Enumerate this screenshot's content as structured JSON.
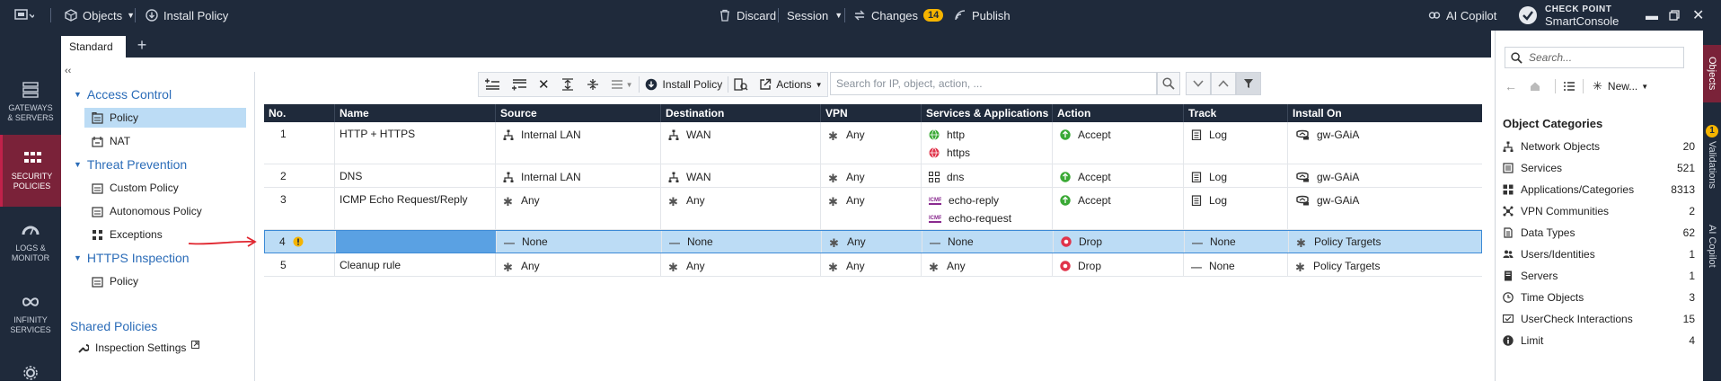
{
  "topbar": {
    "objects_label": "Objects",
    "install_label": "Install Policy",
    "discard_label": "Discard",
    "session_label": "Session",
    "changes_label": "Changes",
    "changes_count": "14",
    "publish_label": "Publish",
    "copilot_label": "AI Copilot",
    "brand_top": "CHECK POINT",
    "brand_bottom": "SmartConsole"
  },
  "tabs": {
    "active": "Standard"
  },
  "leftnav": [
    {
      "line1": "GATEWAYS",
      "line2": "& SERVERS"
    },
    {
      "line1": "SECURITY",
      "line2": "POLICIES"
    },
    {
      "line1": "LOGS &",
      "line2": "MONITOR"
    },
    {
      "line1": "INFINITY",
      "line2": "SERVICES"
    }
  ],
  "tree": {
    "access_control": "Access Control",
    "policy": "Policy",
    "nat": "NAT",
    "threat_prevention": "Threat Prevention",
    "custom_policy": "Custom Policy",
    "autonomous_policy": "Autonomous Policy",
    "exceptions": "Exceptions",
    "https_inspection": "HTTPS Inspection",
    "policy2": "Policy",
    "shared_policies": "Shared Policies",
    "inspection_settings": "Inspection Settings"
  },
  "toolbar": {
    "install_label": "Install Policy",
    "actions_label": "Actions",
    "search_placeholder": "Search for IP, object, action, ..."
  },
  "columns": [
    "No.",
    "Name",
    "Source",
    "Destination",
    "VPN",
    "Services & Applications",
    "Action",
    "Track",
    "Install On"
  ],
  "rules": [
    {
      "no": "1",
      "name": "HTTP + HTTPS",
      "source": "Internal LAN",
      "destination": "WAN",
      "vpn": "Any",
      "services": [
        "http",
        "https"
      ],
      "action": "Accept",
      "track": "Log",
      "install_on": "gw-GAiA"
    },
    {
      "no": "2",
      "name": "DNS",
      "source": "Internal LAN",
      "destination": "WAN",
      "vpn": "Any",
      "services": [
        "dns"
      ],
      "action": "Accept",
      "track": "Log",
      "install_on": "gw-GAiA"
    },
    {
      "no": "3",
      "name": "ICMP Echo Request/Reply",
      "source": "Any",
      "destination": "Any",
      "vpn": "Any",
      "services": [
        "echo-reply",
        "echo-request"
      ],
      "action": "Accept",
      "track": "Log",
      "install_on": "gw-GAiA"
    },
    {
      "no": "4",
      "name": "",
      "source": "None",
      "destination": "None",
      "vpn": "Any",
      "services": [
        "None"
      ],
      "action": "Drop",
      "track": "None",
      "install_on": "Policy Targets"
    },
    {
      "no": "5",
      "name": "Cleanup rule",
      "source": "Any",
      "destination": "Any",
      "vpn": "Any",
      "services": [
        "Any"
      ],
      "action": "Drop",
      "track": "None",
      "install_on": "Policy Targets"
    }
  ],
  "rightpanel": {
    "search_placeholder": "Search...",
    "new_label": "New...",
    "title": "Object Categories",
    "categories": [
      {
        "label": "Network Objects",
        "count": "20"
      },
      {
        "label": "Services",
        "count": "521"
      },
      {
        "label": "Applications/Categories",
        "count": "8313"
      },
      {
        "label": "VPN Communities",
        "count": "2"
      },
      {
        "label": "Data Types",
        "count": "62"
      },
      {
        "label": "Users/Identities",
        "count": "1"
      },
      {
        "label": "Servers",
        "count": "1"
      },
      {
        "label": "Time Objects",
        "count": "3"
      },
      {
        "label": "UserCheck Interactions",
        "count": "15"
      },
      {
        "label": "Limit",
        "count": "4"
      }
    ]
  },
  "vtabs": {
    "objects": "Objects",
    "validations_count": "1",
    "validations": "Validations",
    "copilot": "AI Copilot"
  },
  "colors": {
    "dark": "#1f2a3b",
    "accent": "#7a2239",
    "link": "#2b6cb8",
    "selected_row": "#bcdcf5",
    "accept": "#3aa935",
    "drop": "#e0334a",
    "badge": "#f5b400"
  }
}
